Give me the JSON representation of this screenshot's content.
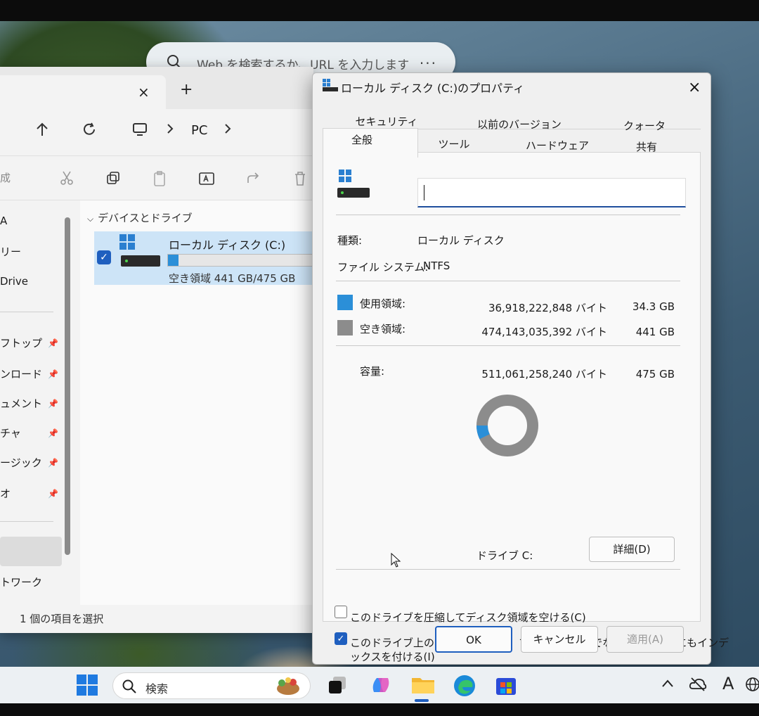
{
  "browser": {
    "search_placeholder": "Web を検索するか、URL を入力します",
    "more": "..."
  },
  "explorer": {
    "tab_close": "×",
    "tab_add": "+",
    "address": "PC",
    "cmd_new_fragment": "成",
    "sidebar_items": [
      "A",
      "リー",
      "Drive",
      "フトップ",
      "ンロード",
      "ュメント",
      "チャ",
      "ージック",
      "オ",
      "トワーク"
    ],
    "group_title": "デバイスとドライブ",
    "drive": {
      "name": "ローカル ディスク (C:)",
      "free_text": "空き領域 441 GB/475 GB",
      "used_fraction": 0.072
    },
    "status": "1 個の項目を選択"
  },
  "dialog": {
    "title": "ローカル ディスク (C:)のプロパティ",
    "close": "×",
    "tabs_back": [
      "セキュリティ",
      "以前のバージョン",
      "クォータ"
    ],
    "tabs_front": [
      "全般",
      "ツール",
      "ハードウェア",
      "共有"
    ],
    "name_value": "",
    "type_label": "種類:",
    "type_value": "ローカル ディスク",
    "fs_label": "ファイル システム:",
    "fs_value": "NTFS",
    "used_label": "使用領域:",
    "used_bytes": "36,918,222,848 バイト",
    "used_size": "34.3 GB",
    "free_label": "空き領域:",
    "free_bytes": "474,143,035,392 バイト",
    "free_size": "441 GB",
    "cap_label": "容量:",
    "cap_bytes": "511,061,258,240 バイト",
    "cap_size": "475 GB",
    "used_fraction": 0.072,
    "drive_label": "ドライブ C:",
    "details_button": "詳細(D)",
    "compress_label": "このドライブを圧縮してディスク領域を空ける(C)",
    "compress_checked": false,
    "index_label_1": "このドライブ上のファイルに対し、プロパティだけでなくコンテンツにもインデ",
    "index_label_2": "ックスを付ける(I)",
    "index_checked": true,
    "ok_button": "OK",
    "cancel_button": "キャンセル",
    "apply_button": "適用(A)",
    "colors": {
      "used": "#2b8fd8",
      "free": "#8c8c8c"
    }
  },
  "taskbar": {
    "search_placeholder": "検索",
    "tray_letter": "A"
  }
}
